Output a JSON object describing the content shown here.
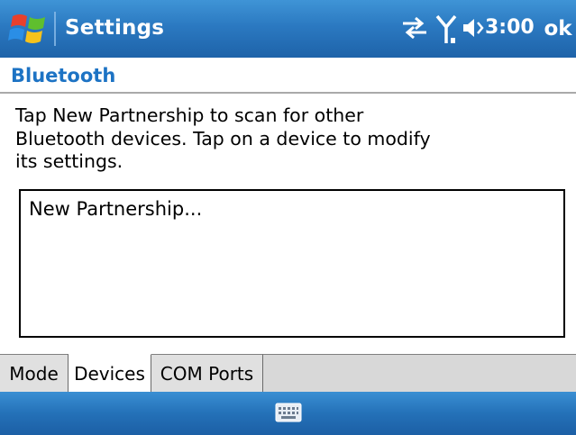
{
  "titlebar": {
    "app_title": "Settings",
    "time": "3:00",
    "ok_label": "ok",
    "icons": [
      "windows-start-icon",
      "connectivity-icon",
      "signal-icon",
      "speaker-icon"
    ]
  },
  "page": {
    "heading": "Bluetooth",
    "instructions": "Tap New Partnership to scan for other\nBluetooth devices. Tap on a device to modify\nits settings."
  },
  "list": {
    "items": [
      "New Partnership..."
    ]
  },
  "tabs": [
    {
      "label": "Mode",
      "active": false
    },
    {
      "label": "Devices",
      "active": true
    },
    {
      "label": "COM Ports",
      "active": false
    }
  ],
  "bottombar": {
    "icons": [
      "keyboard-icon"
    ]
  },
  "colors": {
    "titlebar_blue": "#2b79c1",
    "heading_blue": "#1d73c4"
  }
}
